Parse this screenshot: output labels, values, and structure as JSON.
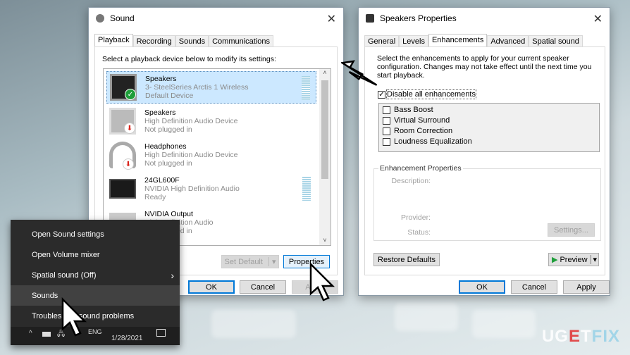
{
  "sound_dialog": {
    "title": "Sound",
    "tabs": [
      "Playback",
      "Recording",
      "Sounds",
      "Communications"
    ],
    "active_tab": "Playback",
    "instruction": "Select a playback device below to modify its settings:",
    "devices": [
      {
        "name": "Speakers",
        "description": "3- SteelSeries Arctis 1 Wireless",
        "status": "Default Device",
        "icon": "speaker-icon",
        "badge": "check-icon",
        "selected": true
      },
      {
        "name": "Speakers",
        "description": "High Definition Audio Device",
        "status": "Not plugged in",
        "icon": "speaker-icon",
        "badge": "unplugged-icon"
      },
      {
        "name": "Headphones",
        "description": "High Definition Audio Device",
        "status": "Not plugged in",
        "icon": "headphones-icon",
        "badge": "unplugged-icon"
      },
      {
        "name": "24GL600F",
        "description": "NVIDIA High Definition Audio",
        "status": "Ready",
        "icon": "monitor-icon"
      },
      {
        "name": "NVIDIA Output",
        "description": "High Definition Audio",
        "status": "Not plugged in",
        "icon": "monitor-icon"
      }
    ],
    "set_default": "Set Default",
    "properties": "Properties",
    "ok": "OK",
    "cancel": "Cancel",
    "apply": "Apply"
  },
  "context_menu": {
    "items": [
      "Open Sound settings",
      "Open Volume mixer",
      "Spatial sound (Off)",
      "Sounds",
      "Troubleshoot sound problems"
    ],
    "highlighted": "Sounds"
  },
  "taskbar": {
    "language": "ENG",
    "date": "1/28/2021"
  },
  "properties_dialog": {
    "title": "Speakers Properties",
    "tabs": [
      "General",
      "Levels",
      "Enhancements",
      "Advanced",
      "Spatial sound"
    ],
    "active_tab": "Enhancements",
    "instruction": "Select the enhancements to apply for your current speaker configuration. Changes may not take effect until the next time you start playback.",
    "disable_all": {
      "label": "Disable all enhancements",
      "checked": true
    },
    "enhancements": [
      {
        "label": "Bass Boost",
        "checked": false
      },
      {
        "label": "Virtual Surround",
        "checked": false
      },
      {
        "label": "Room Correction",
        "checked": false
      },
      {
        "label": "Loudness Equalization",
        "checked": false
      }
    ],
    "group_title": "Enhancement Properties",
    "description_label": "Description:",
    "provider_label": "Provider:",
    "status_label": "Status:",
    "settings": "Settings...",
    "restore_defaults": "Restore Defaults",
    "preview": "Preview",
    "ok": "OK",
    "cancel": "Cancel",
    "apply": "Apply"
  },
  "watermark": {
    "text": "UGETFIX"
  },
  "colors": {
    "selection": "#cce8ff",
    "accent": "#0078d7",
    "menu_bg": "#2b2b2b",
    "check_green": "#1e9e3a",
    "unplug_red": "#d9241c"
  }
}
